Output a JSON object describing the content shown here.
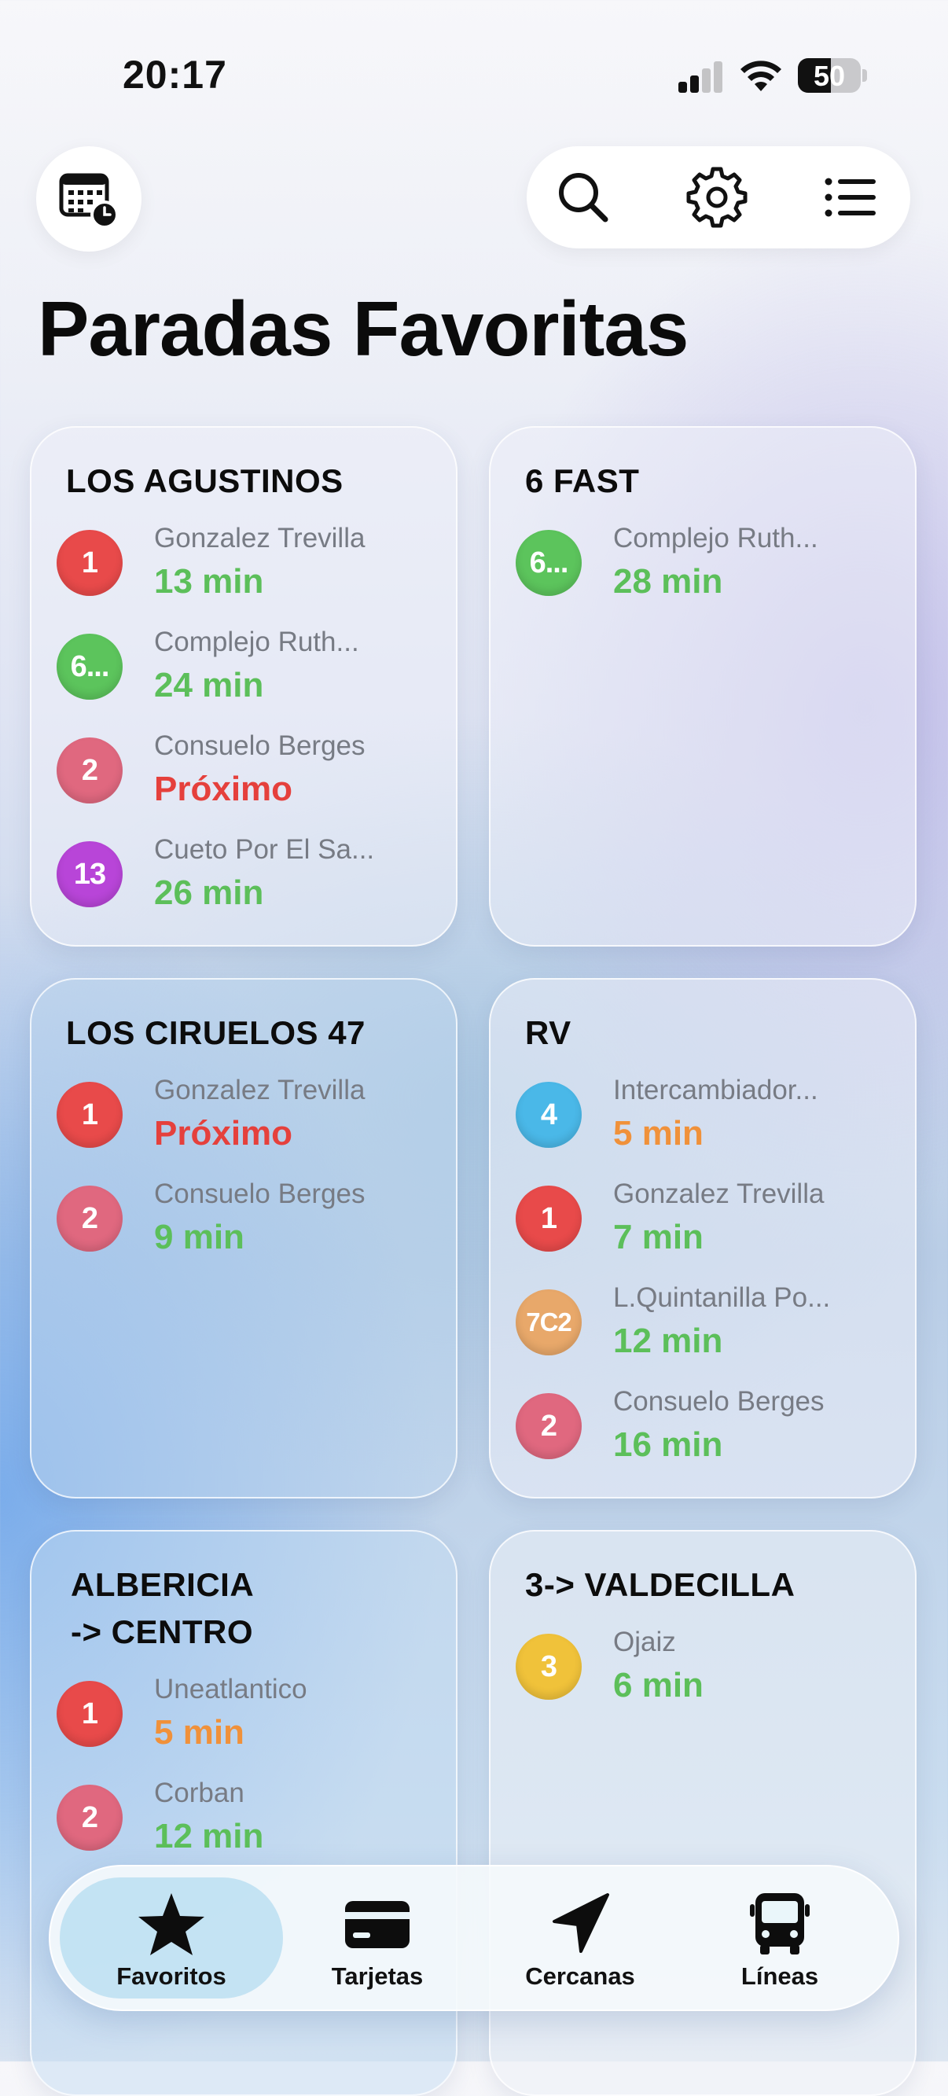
{
  "status_bar": {
    "time": "20:17",
    "battery": "50"
  },
  "page_title": "Paradas Favoritas",
  "cards": [
    {
      "title": "LOS AGUSTINOS",
      "rows": [
        {
          "badge": "1",
          "badge_color": "#e84a4a",
          "stop": "Gonzalez Trevilla",
          "arrival": "13 min",
          "arrival_color": "#5cbf5a"
        },
        {
          "badge": "6...",
          "badge_color": "#5cc45c",
          "stop": "Complejo Ruth...",
          "arrival": "24 min",
          "arrival_color": "#5cbf5a"
        },
        {
          "badge": "2",
          "badge_color": "#e0687f",
          "stop": "Consuelo Berges",
          "arrival": "Próximo",
          "arrival_color": "#e5403c"
        },
        {
          "badge": "13",
          "badge_color": "#b845d8",
          "stop": "Cueto Por El Sa...",
          "arrival": "26 min",
          "arrival_color": "#5cbf5a"
        }
      ]
    },
    {
      "title": "6 FAST",
      "rows": [
        {
          "badge": "6...",
          "badge_color": "#5cc45c",
          "stop": "Complejo Ruth...",
          "arrival": "28 min",
          "arrival_color": "#5cbf5a"
        }
      ]
    },
    {
      "title": "LOS CIRUELOS 47",
      "rows": [
        {
          "badge": "1",
          "badge_color": "#e84a4a",
          "stop": "Gonzalez Trevilla",
          "arrival": "Próximo",
          "arrival_color": "#e5403c"
        },
        {
          "badge": "2",
          "badge_color": "#e0687f",
          "stop": "Consuelo Berges",
          "arrival": "9 min",
          "arrival_color": "#5cbf5a"
        }
      ]
    },
    {
      "title": "RV",
      "rows": [
        {
          "badge": "4",
          "badge_color": "#4ab8e8",
          "stop": "Intercambiador...",
          "arrival": "5 min",
          "arrival_color": "#f0913a"
        },
        {
          "badge": "1",
          "badge_color": "#e84a4a",
          "stop": "Gonzalez Trevilla",
          "arrival": "7 min",
          "arrival_color": "#5cbf5a"
        },
        {
          "badge": "7C2",
          "badge_color": "#e8a86a",
          "stop": "L.Quintanilla Po...",
          "arrival": "12 min",
          "arrival_color": "#5cbf5a"
        },
        {
          "badge": "2",
          "badge_color": "#e0687f",
          "stop": "Consuelo Berges",
          "arrival": "16 min",
          "arrival_color": "#5cbf5a"
        }
      ]
    },
    {
      "title_line1": "ALBERICIA",
      "title_line2": "-> CENTRO",
      "rows": [
        {
          "badge": "1",
          "badge_color": "#e84a4a",
          "stop": "Uneatlantico",
          "arrival": "5 min",
          "arrival_color": "#f0913a"
        },
        {
          "badge": "2",
          "badge_color": "#e0687f",
          "stop": "Corban",
          "arrival": "12 min",
          "arrival_color": "#5cbf5a"
        }
      ]
    },
    {
      "title": "3-> VALDECILLA",
      "rows": [
        {
          "badge": "3",
          "badge_color": "#f0c23a",
          "stop": "Ojaiz",
          "arrival": "6 min",
          "arrival_color": "#5cbf5a"
        }
      ]
    }
  ],
  "tabs": [
    {
      "label": "Favoritos",
      "icon": "star-icon",
      "active": true
    },
    {
      "label": "Tarjetas",
      "icon": "card-icon",
      "active": false
    },
    {
      "label": "Cercanas",
      "icon": "location-arrow-icon",
      "active": false
    },
    {
      "label": "Líneas",
      "icon": "bus-icon",
      "active": false
    }
  ]
}
